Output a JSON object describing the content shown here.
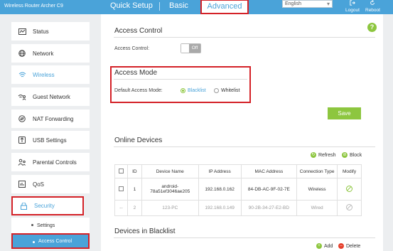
{
  "header": {
    "brand": "Wireless Router Archer C9",
    "nav": {
      "quick_setup": "Quick Setup",
      "basic": "Basic",
      "advanced": "Advanced"
    },
    "language": "English",
    "logout": "Logout",
    "reboot": "Reboot"
  },
  "sidebar": {
    "items": [
      {
        "label": "Status",
        "icon": "status-icon"
      },
      {
        "label": "Network",
        "icon": "globe-icon"
      },
      {
        "label": "Wireless",
        "icon": "wifi-icon"
      },
      {
        "label": "Guest Network",
        "icon": "guest-icon"
      },
      {
        "label": "NAT Forwarding",
        "icon": "nat-icon"
      },
      {
        "label": "USB Settings",
        "icon": "usb-icon"
      },
      {
        "label": "Parental Controls",
        "icon": "parental-icon"
      },
      {
        "label": "QoS",
        "icon": "qos-icon"
      },
      {
        "label": "Security",
        "icon": "lock-icon"
      }
    ],
    "sub_items": [
      {
        "label": "Settings"
      },
      {
        "label": "Access Control"
      }
    ]
  },
  "access_control": {
    "title": "Access Control",
    "label": "Access Control:",
    "toggle_state": "Off"
  },
  "access_mode": {
    "title": "Access Mode",
    "label": "Default Access Mode:",
    "options": [
      "Blacklist",
      "Whitelist"
    ],
    "selected": "Blacklist"
  },
  "save_label": "Save",
  "online_devices": {
    "title": "Online Devices",
    "refresh": "Refresh",
    "block": "Block",
    "columns": [
      "ID",
      "Device Name",
      "IP Address",
      "MAC Address",
      "Connection Type",
      "Modify"
    ],
    "rows": [
      {
        "id": "1",
        "name_line1": "android-",
        "name_line2": "78a51ef3046ae205",
        "ip": "192.168.0.162",
        "mac": "84-DB-AC-9F-02-7E",
        "type": "Wireless",
        "checkbox": "☐"
      },
      {
        "id": "2",
        "name_line1": "123-PC",
        "name_line2": "",
        "ip": "192.168.0.149",
        "mac": "90-2B-34-27-E2-BD",
        "type": "Wired",
        "checkbox": "--"
      }
    ]
  },
  "blacklist": {
    "title": "Devices in Blacklist",
    "add": "Add",
    "delete": "Delete"
  },
  "help": "?",
  "colors": {
    "accent": "#4aa3d9",
    "green": "#8dc63f",
    "highlight": "#d42127",
    "delete": "#e5412d"
  }
}
